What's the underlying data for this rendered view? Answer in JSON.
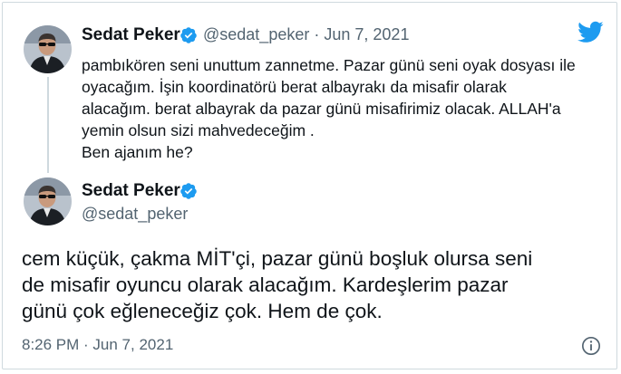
{
  "tweet1": {
    "author_name": "Sedat Peker",
    "handle": "@sedat_peker",
    "separator": "·",
    "date": "Jun 7, 2021",
    "lines": [
      "pambıkören seni unuttum zannetme. Pazar günü seni oyak dosyası ile",
      "oyacağım. İşin koordinatörü berat albayrakı da misafir olarak",
      "alacağım. berat albayrak da pazar günü misafirimiz olacak. ALLAH'a",
      "yemin olsun sizi mahvedeceğim .",
      "Ben ajanım he?"
    ]
  },
  "tweet2": {
    "author_name": "Sedat Peker",
    "handle": "@sedat_peker",
    "lines": [
      "cem küçük, çakma MİT'çi, pazar günü boşluk olursa seni",
      "de misafir oyuncu olarak alacağım. Kardeşlerim pazar",
      "günü çok eğleneceğiz çok. Hem de çok."
    ],
    "timestamp": "8:26 PM · Jun 7, 2021"
  },
  "icons": {
    "brand": "twitter-bird-icon",
    "verified": "verified-badge-icon",
    "info": "info-icon"
  },
  "colors": {
    "twitter_blue": "#1d9bf0",
    "text": "#0f1419",
    "secondary_text": "#536471",
    "border": "#cfd9de"
  }
}
